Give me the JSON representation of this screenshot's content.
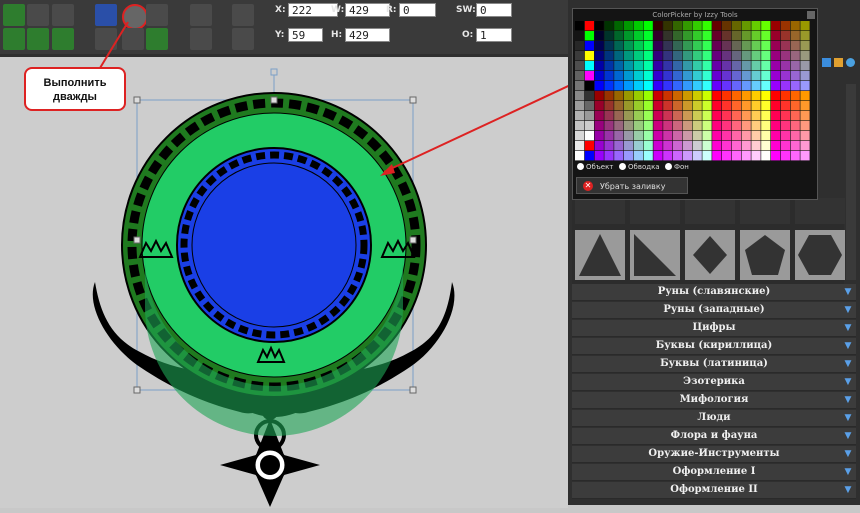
{
  "toolbar": {
    "x_label": "X:",
    "x_value": "222",
    "w_label": "W:",
    "w_value": "429",
    "r_label": "R:",
    "r_value": "0",
    "sw_label": "SW:",
    "sw_value": "0",
    "y_label": "Y:",
    "y_value": "59",
    "h_label": "H:",
    "h_value": "429",
    "o_label": "O:",
    "o_value": "1"
  },
  "callout": {
    "line1": "Выполнить",
    "line2": "дважды"
  },
  "picker": {
    "title": "ColorPicker by Izzy Tools",
    "radio_object": "Объект",
    "radio_stroke": "Обводка",
    "radio_background": "Фон",
    "clear_fill": "Убрать заливку"
  },
  "categories": [
    "Руны (славянские)",
    "Руны (западные)",
    "Цифры",
    "Буквы (кириллица)",
    "Буквы (латиница)",
    "Эзотерика",
    "Мифология",
    "Люди",
    "Флора и фауна",
    "Оружие-Инструменты",
    "Оформление I",
    "Оформление II"
  ],
  "colors": {
    "accent_red": "#dd2222",
    "ring_dark": "#1f7a1f",
    "ring_light": "#22cc66",
    "center_blue": "#1a3fe6"
  }
}
